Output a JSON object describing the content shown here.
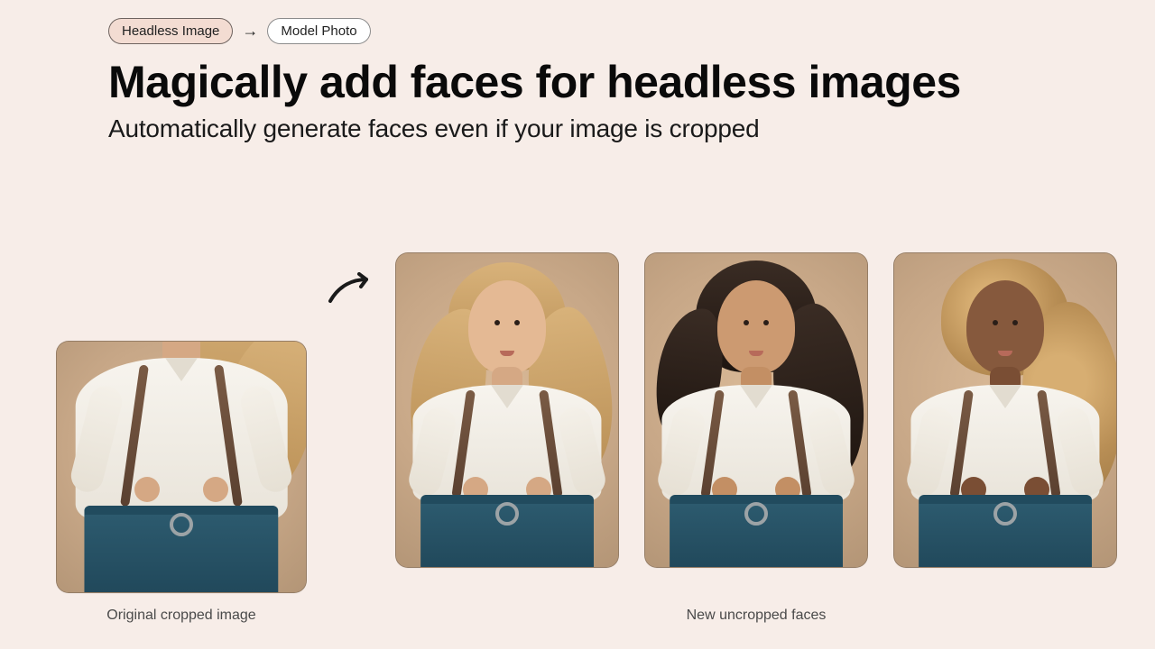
{
  "pills": {
    "from": "Headless Image",
    "to": "Model Photo"
  },
  "headline": "Magically add faces for headless images",
  "subhead": "Automatically generate faces even if your image is cropped",
  "captions": {
    "original": "Original cropped image",
    "generated": "New uncropped faces"
  }
}
